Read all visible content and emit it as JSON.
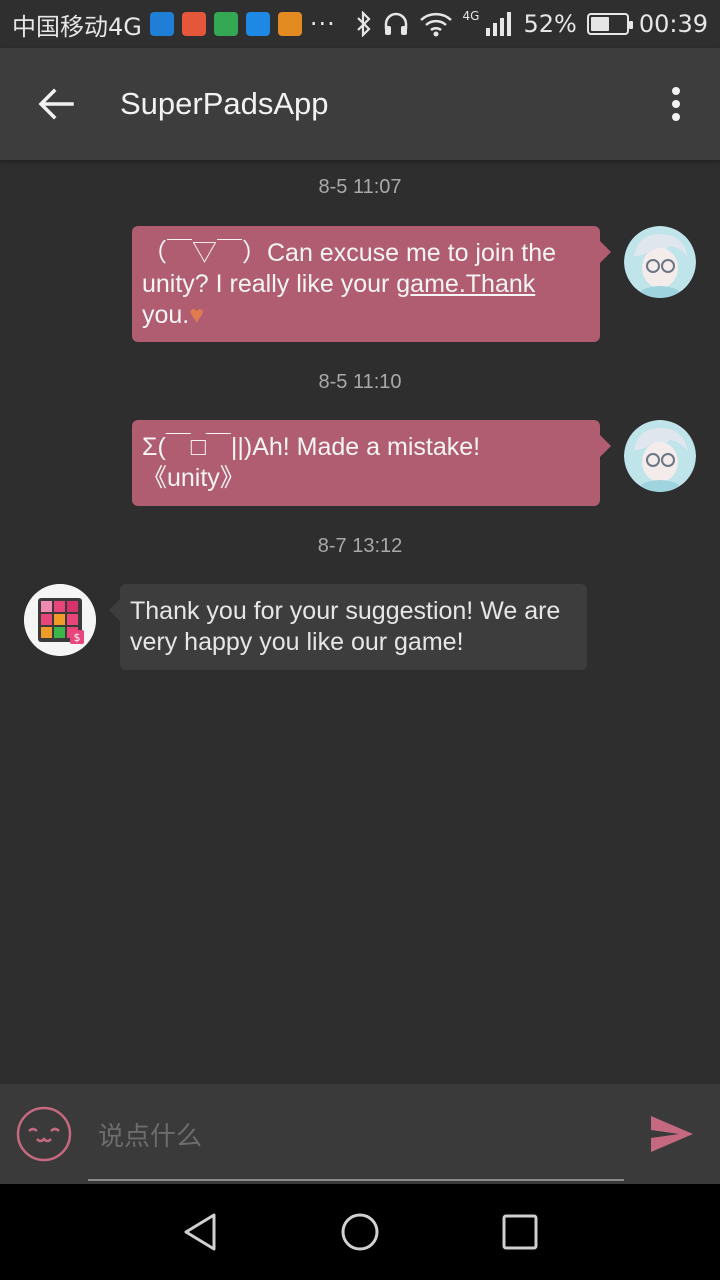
{
  "status_bar": {
    "carrier": "中国移动4G",
    "more_indicator": "···",
    "network_type": "4G",
    "battery_text": "52%",
    "battery_level": 0.52,
    "time": "00:39",
    "app_icons": [
      {
        "name": "chat-app-icon",
        "color": "#1f7fd6"
      },
      {
        "name": "weibo-app-icon",
        "color": "#e5573b"
      },
      {
        "name": "grid-app-icon",
        "color": "#34a853"
      },
      {
        "name": "video-app-icon",
        "color": "#1e88e5"
      },
      {
        "name": "media-app-icon",
        "color": "#e38a20"
      }
    ]
  },
  "app_bar": {
    "title": "SuperPadsApp"
  },
  "messages": [
    {
      "timestamp": "8-5 11:07",
      "direction": "outgoing",
      "line1": "（￣▽￣）Can excuse me to join the",
      "line2_plain": "unity?  I really like your ",
      "line2_link": "game.Thank",
      "line3": "you.",
      "emoji": "♥"
    },
    {
      "timestamp": "8-5 11:10",
      "direction": "outgoing",
      "line1": "Σ(￣□￣||)Ah! Made a mistake!",
      "line2": "《unity》"
    },
    {
      "timestamp": "8-7 13:12",
      "direction": "incoming",
      "line1": "Thank you for your suggestion! We are",
      "line2": "very happy you like our game!"
    }
  ],
  "input_bar": {
    "placeholder": "说点什么",
    "value": ""
  },
  "colors": {
    "outgoing_bubble": "#b05d72",
    "incoming_bubble": "#3d3d3d",
    "accent_send": "#c4697f",
    "background": "#2e2e2e"
  }
}
